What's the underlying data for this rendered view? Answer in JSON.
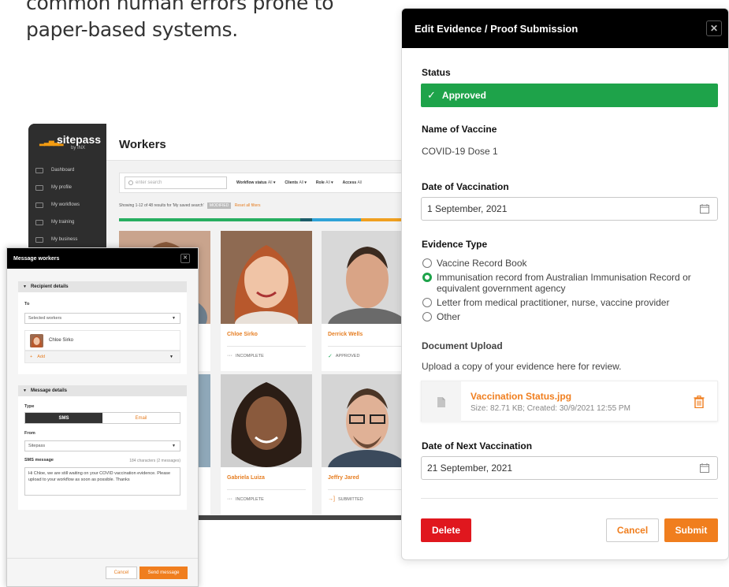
{
  "hero": {
    "line1": "common human errors prone to",
    "line2": "paper-based systems."
  },
  "laptop": {
    "logo": {
      "name": "sitepass",
      "by": "by INX"
    },
    "nav": [
      {
        "label": "Dashboard"
      },
      {
        "label": "My profile"
      },
      {
        "label": "My workflows"
      },
      {
        "label": "My training"
      },
      {
        "label": "My business"
      }
    ],
    "page_title": "Workers",
    "search_placeholder": "enter search",
    "filters": [
      {
        "label": "Workflow status",
        "value": "All"
      },
      {
        "label": "Clients",
        "value": "All"
      },
      {
        "label": "Role",
        "value": "All"
      },
      {
        "label": "Access",
        "value": "All"
      }
    ],
    "showing": "Showing 1-12 of 48 results for 'My saved search'",
    "modified": "MODIFIED",
    "reset": "Reset all filters",
    "cards": [
      {
        "name": "Chloe Sirko",
        "status": "INCOMPLETE",
        "status_icon": "dots-icon"
      },
      {
        "name": "Derrick Wells",
        "status": "APPROVED",
        "status_icon": "check-icon"
      },
      {
        "name": "Gabriela Luiza",
        "status": "INCOMPLETE",
        "status_icon": "dots-icon"
      },
      {
        "name": "Jeffry Jared",
        "status": "SUBMITTED",
        "status_icon": "submit-icon"
      }
    ],
    "colors": {
      "accent": "#e67e22",
      "green": "#27ae60",
      "blue": "#2fa3d8",
      "dark": "#333333"
    }
  },
  "message_workers": {
    "title": "Message workers",
    "recipient_section": "Recipient details",
    "to_label": "To",
    "to_select": "Selected workers",
    "worker": "Chloe Sirko",
    "add": "Add",
    "message_section": "Message details",
    "type_label": "Type",
    "type_sms": "SMS",
    "type_email": "Email",
    "from_label": "From",
    "from_value": "Sitepass",
    "sms_label": "SMS message",
    "char_count": "184 characters (2 messages)",
    "message": "Hi Chloe, we are still waiting on your COVID vaccination evidence. Please upload to your workflow as soon as possible. Thanks",
    "cancel": "Cancel",
    "send": "Send message"
  },
  "edit_evidence": {
    "title": "Edit Evidence / Proof Submission",
    "status_label": "Status",
    "status_value": "Approved",
    "vaccine_label": "Name of Vaccine",
    "vaccine_value": "COVID-19 Dose 1",
    "date_label": "Date of Vaccination",
    "date_value": "1 September, 2021",
    "evidence_label": "Evidence Type",
    "options": [
      {
        "label": "Vaccine Record Book",
        "selected": false
      },
      {
        "label": "Immunisation record from Australian Immunisation Record or equivalent government agency",
        "selected": true
      },
      {
        "label": "Letter from medical practitioner, nurse, vaccine provider",
        "selected": false
      },
      {
        "label": "Other",
        "selected": false
      }
    ],
    "upload_label": "Document Upload",
    "upload_help": "Upload a copy of your evidence here for review.",
    "file_name": "Vaccination Status.jpg",
    "file_meta": "Size: 82.71 KB; Created: 30/9/2021 12:55 PM",
    "next_label": "Date of Next Vaccination",
    "next_value": "21 September, 2021",
    "delete": "Delete",
    "cancel": "Cancel",
    "submit": "Submit",
    "colors": {
      "approved": "#1ea34a",
      "accent": "#f07e1e",
      "danger": "#e0171e"
    }
  }
}
